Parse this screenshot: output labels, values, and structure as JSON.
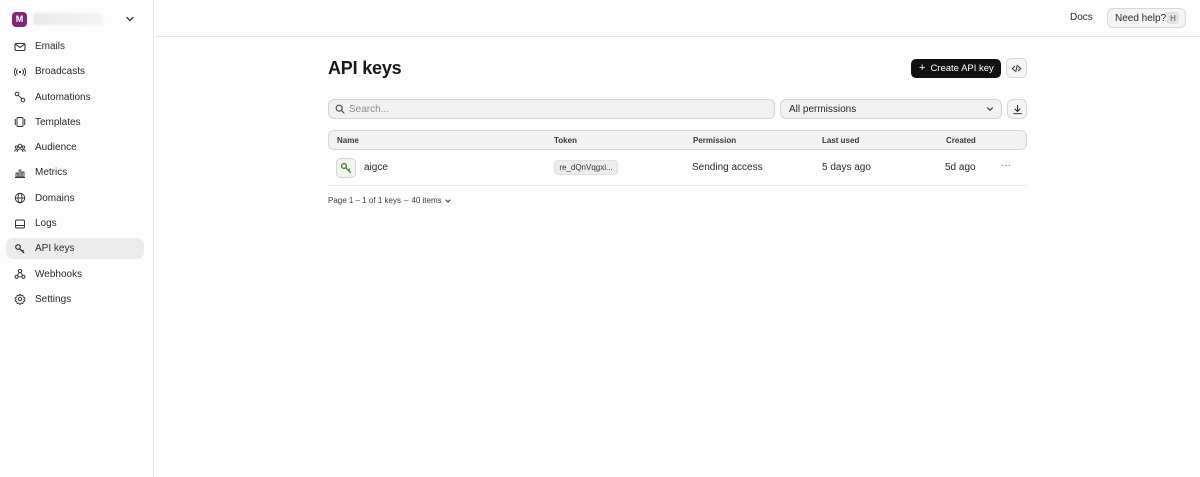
{
  "team": {
    "initial": "M"
  },
  "sidebar": {
    "items": [
      {
        "label": "Emails",
        "icon": "mail-icon"
      },
      {
        "label": "Broadcasts",
        "icon": "broadcast-icon"
      },
      {
        "label": "Automations",
        "icon": "automation-icon"
      },
      {
        "label": "Templates",
        "icon": "templates-icon"
      },
      {
        "label": "Audience",
        "icon": "audience-icon"
      },
      {
        "label": "Metrics",
        "icon": "metrics-icon"
      },
      {
        "label": "Domains",
        "icon": "globe-icon"
      },
      {
        "label": "Logs",
        "icon": "logs-icon"
      },
      {
        "label": "API keys",
        "icon": "key-icon",
        "active": true
      },
      {
        "label": "Webhooks",
        "icon": "webhook-icon"
      },
      {
        "label": "Settings",
        "icon": "gear-icon"
      }
    ]
  },
  "topbar": {
    "docs_label": "Docs",
    "help_label": "Need help?",
    "help_shortcut": "H"
  },
  "page": {
    "title": "API keys",
    "create_label": "Create API key"
  },
  "filters": {
    "search_placeholder": "Search...",
    "permission_selected": "All permissions"
  },
  "table": {
    "columns": [
      "Name",
      "Token",
      "Permission",
      "Last used",
      "Created"
    ],
    "rows": [
      {
        "name": "aigce",
        "token": "re_dQnVqgxi...",
        "permission": "Sending access",
        "last_used": "5 days ago",
        "created": "5d ago"
      }
    ]
  },
  "pagination": {
    "page_text": "Page 1 – 1 of 1 keys",
    "separator": "–",
    "items_text": "40 items"
  },
  "colors": {
    "accent": "#111111",
    "team_avatar": "#7a2b78",
    "key_icon": "#3f7a2e"
  }
}
